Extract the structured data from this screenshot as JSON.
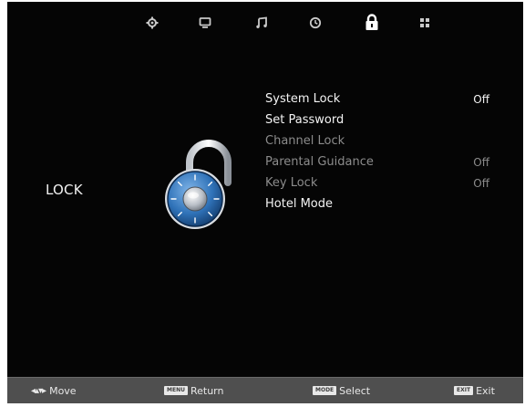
{
  "top_icons": [
    {
      "name": "settings-icon",
      "active": false
    },
    {
      "name": "display-icon",
      "active": false
    },
    {
      "name": "music-icon",
      "active": false
    },
    {
      "name": "clock-icon",
      "active": false
    },
    {
      "name": "lock-icon",
      "active": true
    },
    {
      "name": "apps-icon",
      "active": false
    }
  ],
  "section": {
    "title": "LOCK"
  },
  "menu": {
    "items": [
      {
        "label": "System Lock",
        "value": "Off",
        "enabled": true
      },
      {
        "label": "Set Password",
        "value": "",
        "enabled": true
      },
      {
        "label": "Channel Lock",
        "value": "",
        "enabled": false
      },
      {
        "label": "Parental Guidance",
        "value": "Off",
        "enabled": false
      },
      {
        "label": "Key Lock",
        "value": "Off",
        "enabled": false
      },
      {
        "label": "Hotel Mode",
        "value": "",
        "enabled": true
      }
    ]
  },
  "footer": {
    "move_label": "Move",
    "return_key": "MENU",
    "return_label": "Return",
    "select_key": "MODE",
    "select_label": "Select",
    "exit_key": "EXIT",
    "exit_label": "Exit"
  },
  "colors": {
    "background": "#050505",
    "bottom_bar": "#4f4f4f",
    "text_enabled": "#f4f4f4",
    "text_disabled": "#8c8c8c",
    "lock_dial": "#2f72b8"
  }
}
